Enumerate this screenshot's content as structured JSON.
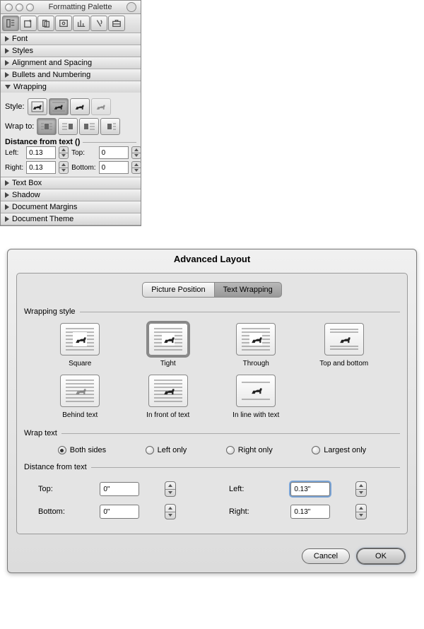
{
  "palette": {
    "title": "Formatting Palette",
    "sections": {
      "font": "Font",
      "styles": "Styles",
      "alignment": "Alignment and Spacing",
      "bullets": "Bullets and Numbering",
      "wrapping": "Wrapping",
      "textbox": "Text Box",
      "shadow": "Shadow",
      "margins": "Document Margins",
      "theme": "Document Theme"
    },
    "wrapping": {
      "style_label": "Style:",
      "wrap_to_label": "Wrap to:",
      "distance_header": "Distance from text ()",
      "left_label": "Left:",
      "right_label": "Right:",
      "top_label": "Top:",
      "bottom_label": "Bottom:",
      "left_value": "0.13",
      "right_value": "0.13",
      "top_value": "0",
      "bottom_value": "0"
    }
  },
  "dialog": {
    "title": "Advanced Layout",
    "tabs": {
      "position": "Picture Position",
      "wrapping": "Text Wrapping"
    },
    "fieldset_style": "Wrapping style",
    "wrap_styles": {
      "square": "Square",
      "tight": "Tight",
      "through": "Through",
      "topbottom": "Top and bottom",
      "behind": "Behind text",
      "front": "In front of text",
      "inline": "In line with text"
    },
    "fieldset_wraptext": "Wrap text",
    "wraptext_options": {
      "both": "Both sides",
      "left": "Left only",
      "right": "Right only",
      "largest": "Largest only"
    },
    "fieldset_distance": "Distance from text",
    "distance": {
      "top_label": "Top:",
      "bottom_label": "Bottom:",
      "left_label": "Left:",
      "right_label": "Right:",
      "top_value": "0\"",
      "bottom_value": "0\"",
      "left_value": "0.13\"",
      "right_value": "0.13\""
    },
    "buttons": {
      "cancel": "Cancel",
      "ok": "OK"
    }
  }
}
